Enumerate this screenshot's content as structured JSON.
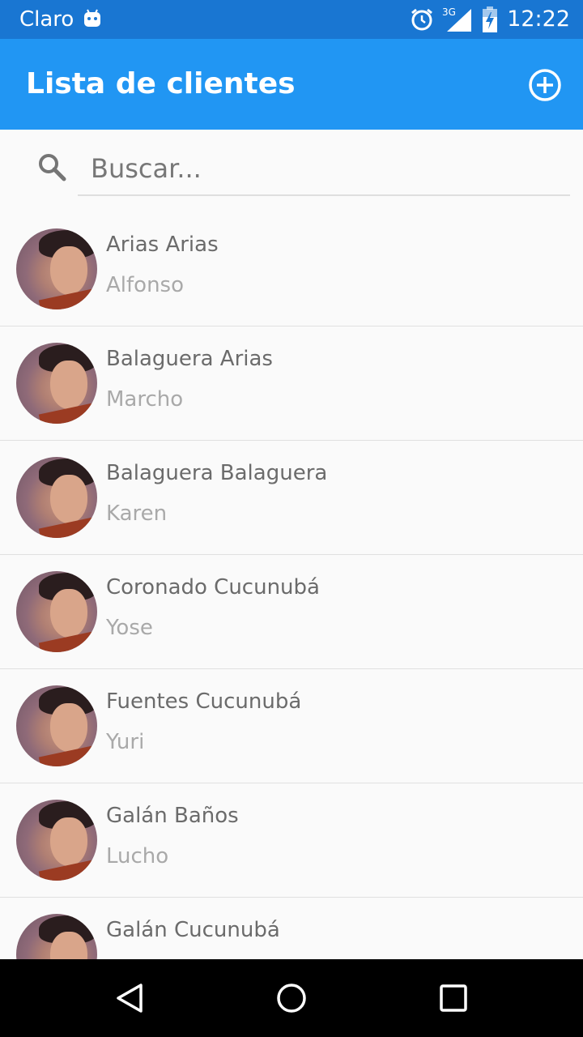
{
  "status_bar": {
    "carrier": "Claro",
    "network": "3G",
    "time": "12:22",
    "icons": [
      "android-icon",
      "alarm-icon",
      "signal-icon",
      "battery-charging-icon"
    ]
  },
  "app_bar": {
    "title": "Lista de clientes",
    "add_icon": "add-circle-icon"
  },
  "search": {
    "placeholder": "Buscar...",
    "value": ""
  },
  "clients": [
    {
      "name": "Arias Arias",
      "subtitle": "Alfonso"
    },
    {
      "name": "Balaguera Arias",
      "subtitle": "Marcho"
    },
    {
      "name": "Balaguera Balaguera",
      "subtitle": "Karen"
    },
    {
      "name": "Coronado Cucunubá",
      "subtitle": "Yose"
    },
    {
      "name": "Fuentes Cucunubá",
      "subtitle": "Yuri"
    },
    {
      "name": "Galán Baños",
      "subtitle": "Lucho"
    },
    {
      "name": "Galán Cucunubá",
      "subtitle": ""
    }
  ],
  "nav_bar": {
    "buttons": [
      "back-icon",
      "home-icon",
      "recent-apps-icon"
    ]
  },
  "colors": {
    "status_bar": "#1976d2",
    "app_bar": "#2196f3",
    "background": "#fafafa",
    "name_text": "#6b6b6b",
    "subtitle_text": "#a9a9a9"
  }
}
